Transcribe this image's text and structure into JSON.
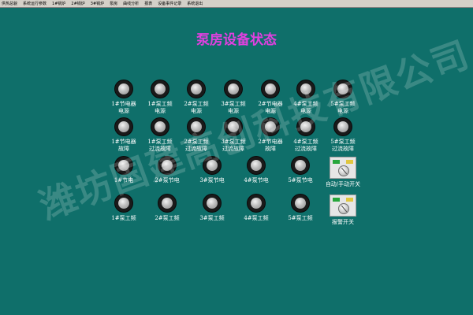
{
  "menu": {
    "items": [
      "供热总貌",
      "系统运行参数",
      "1#锅炉",
      "2#锅炉",
      "3#锅炉",
      "泵房",
      "曲线分析",
      "报表",
      "设备事件记录",
      "系统退出"
    ]
  },
  "page": {
    "title": "泵房设备状态"
  },
  "lamps": {
    "row1": [
      "1#节电器\n电源",
      "1#泵工频\n电源",
      "2#泵工频\n电源",
      "3#泵工频\n电源",
      "2#节电器\n电源",
      "4#泵工频\n电源",
      "5#泵工频\n电源"
    ],
    "row2": [
      "1#节电器\n故障",
      "1#泵工频\n过流故障",
      "2#泵工频\n过流故障",
      "3#泵工频\n过流故障",
      "2#节电器\n故障",
      "4#泵工频\n过流故障",
      "5#泵工频\n过流故障"
    ],
    "row3": [
      "1#节电",
      "2#泵节电",
      "3#泵节电",
      "4#泵节电",
      "5#泵节电"
    ],
    "row4": [
      "1#泵工频",
      "2#泵工频",
      "3#泵工频",
      "4#泵工频",
      "5#泵工频"
    ]
  },
  "switches": {
    "auto_manual_label": "自动/手动开关",
    "alarm_label": "报警开关"
  },
  "watermark": {
    "text": "潍坊国建高创科技有限公司"
  },
  "colors": {
    "background": "#0f6f6a",
    "title": "#e040e0",
    "label": "#ffffff"
  }
}
